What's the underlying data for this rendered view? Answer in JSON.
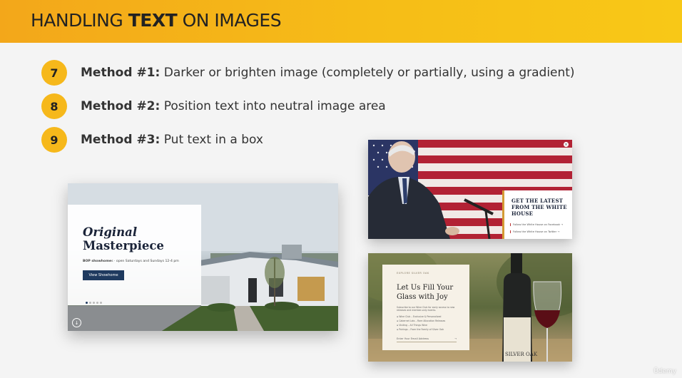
{
  "header": {
    "title_prefix": "HANDLING",
    "title_bold": "TEXT",
    "title_suffix": "ON IMAGES"
  },
  "methods": [
    {
      "num": "7",
      "label": "Method #1:",
      "text": "Darker or brighten image (completely or partially, using a gradient)"
    },
    {
      "num": "8",
      "label": "Method #2:",
      "text": "Position text into neutral image area"
    },
    {
      "num": "9",
      "label": "Method #3:",
      "text": "Put text in a box"
    }
  ],
  "house_card": {
    "title_line1": "Original",
    "title_line2": "Masterpiece",
    "subtitle_bold": "BOP showhome",
    "subtitle": "s · open Saturdays and Sundays 12-4 pm",
    "button": "View Showhome"
  },
  "president_card": {
    "heading_l1": "GET THE LATEST",
    "heading_l2": "FROM THE WHITE",
    "heading_l3": "HOUSE",
    "link1": "Follow the White House on Facebook →",
    "link2": "Follow the White House on Twitter →"
  },
  "wine_card": {
    "kicker": "EXPLORE SILVER OAK",
    "title_l1": "Let Us Fill Your",
    "title_l2": "Glass with Joy",
    "copy": "Subscribe to our Wine Club for early access to new releases and member-only events.",
    "list": [
      "Wine Club – Exclusive & Personalized",
      "Cabernet Lots – Rare Allocation Releases",
      "Visiting – All Things Wine",
      "Pairings – From the Family of Silver Oak"
    ],
    "email_placeholder": "Enter Your Email Address",
    "email_arrow": "→",
    "bottle_label": "SILVER OAK"
  },
  "watermark": "Ūdemy",
  "colors": {
    "accent": "#f6b81b",
    "navy": "#1f3a5f",
    "gold": "#d49b34"
  },
  "icons": {
    "download": "download-icon",
    "close": "close-icon"
  }
}
